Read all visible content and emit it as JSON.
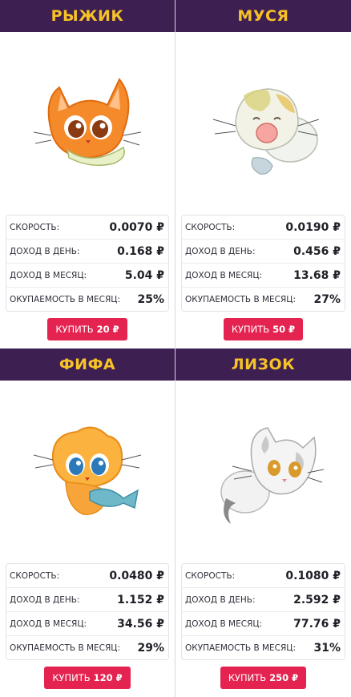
{
  "labels": {
    "speed": "СКОРОСТЬ:",
    "income_day": "ДОХОД В ДЕНЬ:",
    "income_month": "ДОХОД В МЕСЯЦ:",
    "payback": "ОКУПАЕМОСТЬ В МЕСЯЦ:",
    "buy": "КУПИТЬ"
  },
  "cats": [
    {
      "name": "РЫЖИК",
      "icon": "orange-kitten-icon",
      "speed": "0.0070 ₽",
      "income_day": "0.168 ₽",
      "income_month": "5.04 ₽",
      "payback": "25%",
      "price": "20 ₽"
    },
    {
      "name": "МУСЯ",
      "icon": "yawning-kitten-icon",
      "speed": "0.0190 ₽",
      "income_day": "0.456 ₽",
      "income_month": "13.68 ₽",
      "payback": "27%",
      "price": "50 ₽"
    },
    {
      "name": "ФИФА",
      "icon": "kitten-with-fish-icon",
      "speed": "0.0480 ₽",
      "income_day": "1.152 ₽",
      "income_month": "34.56 ₽",
      "payback": "29%",
      "price": "120 ₽"
    },
    {
      "name": "ЛИЗОК",
      "icon": "grey-kitten-icon",
      "speed": "0.1080 ₽",
      "income_day": "2.592 ₽",
      "income_month": "77.76 ₽",
      "payback": "31%",
      "price": "250 ₽"
    }
  ],
  "colors": {
    "header_bg": "#3d1f52",
    "title": "#f6c227",
    "button": "#e42350"
  }
}
